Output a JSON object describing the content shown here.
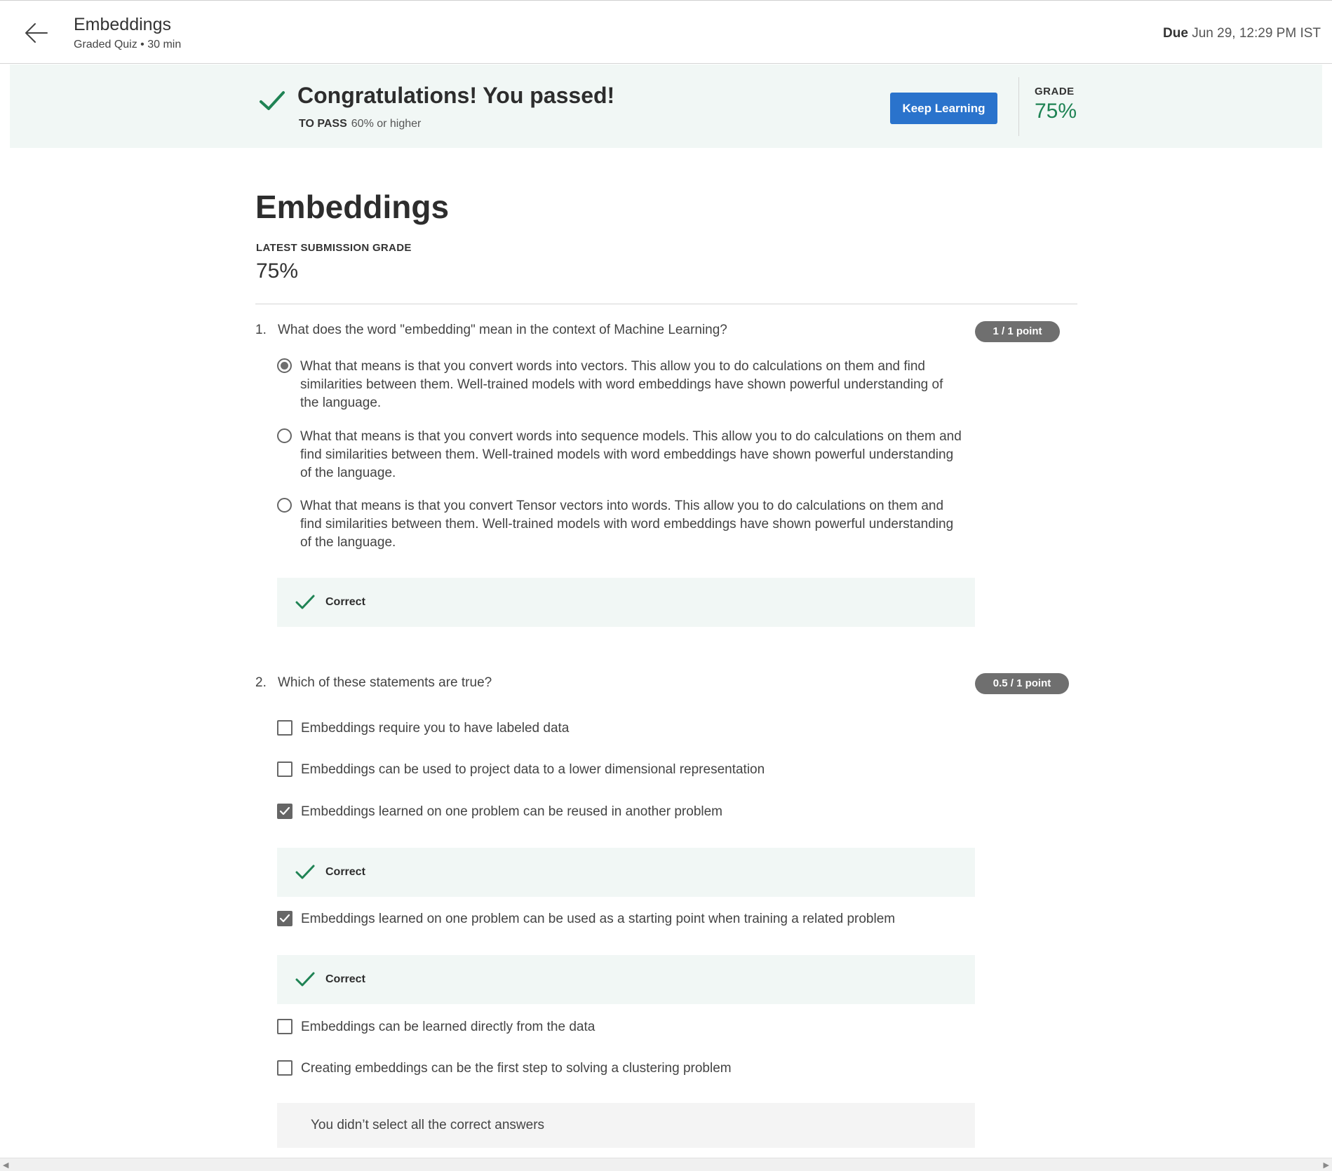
{
  "header": {
    "title": "Embeddings",
    "subtitle": "Graded Quiz • 30 min",
    "due_label": "Due",
    "due_value": "Jun 29, 12:29 PM IST"
  },
  "banner": {
    "title": "Congratulations! You passed!",
    "to_pass_label": "TO PASS",
    "to_pass_value": "60% or higher",
    "keep_learning_label": "Keep Learning",
    "grade_label": "GRADE",
    "grade_value": "75%"
  },
  "page": {
    "title": "Embeddings",
    "latest_label": "LATEST SUBMISSION GRADE",
    "latest_value": "75%"
  },
  "questions": [
    {
      "number": "1.",
      "text": "What does the word \"embedding\" mean in the context of Machine Learning?",
      "points": "1 / 1 point",
      "type": "radio",
      "options": [
        {
          "text": "What that means is that you convert words into vectors. This allow you to do calculations on them and find similarities between them. Well-trained models with word embeddings have shown powerful understanding of the language.",
          "selected": true
        },
        {
          "text": "What that means is that you convert words into sequence models. This allow you to do calculations on them and find similarities between them. Well-trained models with word embeddings have shown powerful understanding of the language.",
          "selected": false
        },
        {
          "text": "What that means is that you convert Tensor vectors into words. This allow you to do calculations on them and find similarities between them. Well-trained models with word embeddings have shown powerful understanding of the language.",
          "selected": false
        }
      ],
      "feedback": "Correct"
    },
    {
      "number": "2.",
      "text": "Which of these statements are true?",
      "points": "0.5 / 1 point",
      "type": "checkbox",
      "options": [
        {
          "text": "Embeddings require you to have labeled data",
          "selected": false
        },
        {
          "text": "Embeddings can be used to project data to a lower dimensional representation",
          "selected": false
        },
        {
          "text": "Embeddings learned on one problem can be reused in another problem",
          "selected": true,
          "feedback": "Correct"
        },
        {
          "text": "Embeddings learned on one problem can be used as a starting point when training a related problem",
          "selected": true,
          "feedback": "Correct"
        },
        {
          "text": "Embeddings can be learned directly from the data",
          "selected": false
        },
        {
          "text": "Creating embeddings can be the first step to solving a clustering problem",
          "selected": false
        }
      ],
      "summary_feedback": "You didn’t select all the correct answers"
    }
  ],
  "colors": {
    "accent_blue": "#2a73cc",
    "success_green": "#1f8354",
    "feedback_bg": "#f1f7f5",
    "pill_gray": "#6f6f6f"
  }
}
